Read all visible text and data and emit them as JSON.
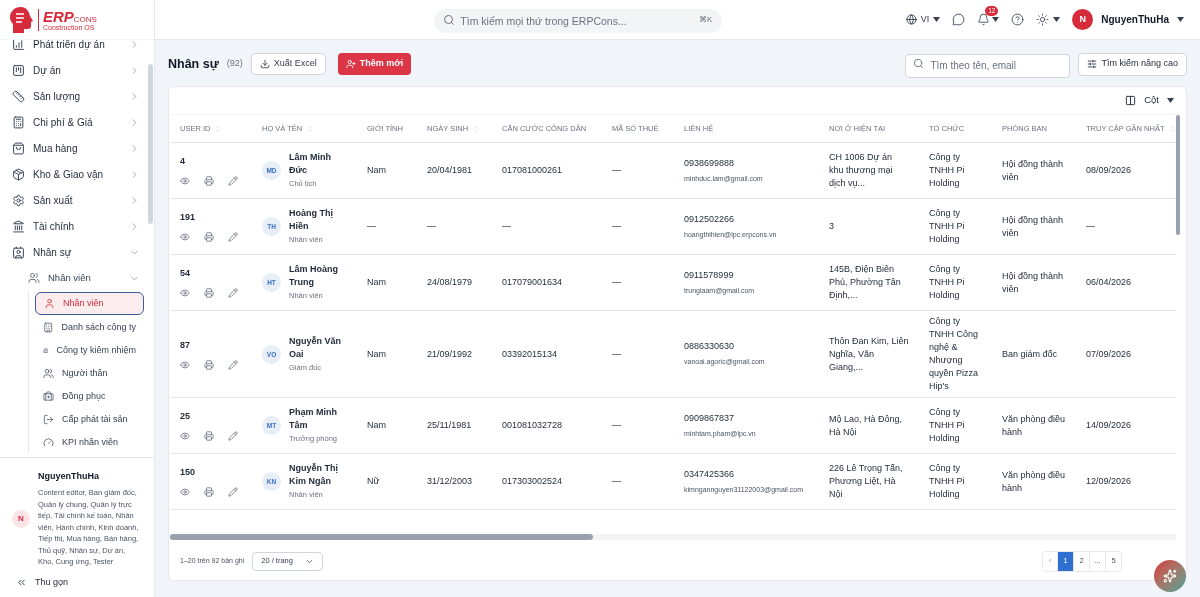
{
  "logo": {
    "name": "ERP",
    "suffix": "CONS",
    "tagline": "Construction OS"
  },
  "header": {
    "search_placeholder": "Tìm kiếm mọi thứ trong ERPCons...",
    "shortcut": "⌘K",
    "language": "VI",
    "notifications": "12",
    "user": "NguyenThuHa",
    "avatar": "N"
  },
  "sidebar": {
    "items": [
      {
        "label": "Phát triển dự án",
        "expanded": false
      },
      {
        "label": "Dự án",
        "expanded": false
      },
      {
        "label": "Sản lượng",
        "expanded": false
      },
      {
        "label": "Chi phí & Giá",
        "expanded": false
      },
      {
        "label": "Mua hàng",
        "expanded": false
      },
      {
        "label": "Kho & Giao vận",
        "expanded": false
      },
      {
        "label": "Sản xuất",
        "expanded": false
      },
      {
        "label": "Tài chính",
        "expanded": false
      },
      {
        "label": "Nhân sự",
        "expanded": true,
        "children": [
          {
            "label": "Nhân viên",
            "expanded": true,
            "children": [
              {
                "label": "Nhân viên",
                "selected": true
              },
              {
                "label": "Danh sách công ty",
                "selected": false
              },
              {
                "label": "Công ty kiêm nhiệm",
                "selected": false
              },
              {
                "label": "Người thân",
                "selected": false
              },
              {
                "label": "Đồng phục",
                "selected": false
              },
              {
                "label": "Cấp phát tài sản",
                "selected": false
              },
              {
                "label": "KPI nhân viên",
                "selected": false
              }
            ]
          }
        ]
      }
    ],
    "user": {
      "name": "NguyenThuHa",
      "avatar": "N",
      "roles": "Content editor, Ban giám đốc, Quản lý chung, Quản lý trực tiếp, Tài chính kế toán, Nhân viên, Hành chính, Kinh doanh, Tiếp thị, Mua hàng, Bán hàng, Thủ quỹ, Nhân sự, Dự án, Kho, Cung ứng, Tester"
    },
    "collapse": "Thu gọn"
  },
  "page": {
    "title": "Nhân sự",
    "count": "(92)",
    "export": "Xuất Excel",
    "add": "Thêm mới",
    "search_placeholder": "Tìm theo tên, email",
    "advanced": "Tìm kiếm nâng cao",
    "columns_button": "Cột"
  },
  "table": {
    "columns": [
      {
        "label": "USER ID",
        "sortable": true
      },
      {
        "label": "HỌ VÀ TÊN",
        "sortable": true
      },
      {
        "label": "GIỚI TÍNH",
        "sortable": false
      },
      {
        "label": "NGÀY SINH",
        "sortable": true
      },
      {
        "label": "CĂN CƯỚC CÔNG DÂN",
        "sortable": false
      },
      {
        "label": "MÃ SỐ THUẾ",
        "sortable": false
      },
      {
        "label": "LIÊN HỆ",
        "sortable": false
      },
      {
        "label": "NƠI Ở HIỆN TẠI",
        "sortable": false
      },
      {
        "label": "TỔ CHỨC",
        "sortable": false
      },
      {
        "label": "PHÒNG BAN",
        "sortable": false
      },
      {
        "label": "TRUY CẬP GẦN NHẤT",
        "sortable": true
      }
    ],
    "rows": [
      {
        "id": "4",
        "initials": "MD",
        "name": "Lâm Minh Đức",
        "role": "Chủ tịch",
        "gender": "Nam",
        "dob": "20/04/1981",
        "cccd": "017081000261",
        "tax": "—",
        "phone": "0938699888",
        "email": "minhduc.lam@gmail.com",
        "address": "CH 1006 Dự án khu thương mại dịch vụ...",
        "org": "Công ty TNHH Pi Holding",
        "dept": "Hội đồng thành viên",
        "last": "08/09/2026"
      },
      {
        "id": "191",
        "initials": "TH",
        "name": "Hoàng Thị Hiền",
        "role": "Nhân viên",
        "gender": "—",
        "dob": "—",
        "cccd": "—",
        "tax": "—",
        "phone": "0912502266",
        "email": "hoangthihien@lpc.erpcons.vn",
        "address": "3",
        "org": "Công ty TNHH Pi Holding",
        "dept": "Hội đồng thành viên",
        "last": "—"
      },
      {
        "id": "54",
        "initials": "HT",
        "name": "Lâm Hoàng Trung",
        "role": "Nhân viên",
        "gender": "Nam",
        "dob": "24/08/1979",
        "cccd": "017079001634",
        "tax": "—",
        "phone": "0911578999",
        "email": "trunglaam@gmail.com",
        "address": "145B, Điện Biên Phủ, Phường Tân Định,...",
        "org": "Công ty TNHH Pi Holding",
        "dept": "Hội đồng thành viên",
        "last": "06/04/2026"
      },
      {
        "id": "87",
        "initials": "VO",
        "name": "Nguyễn Văn Oai",
        "role": "Giám đốc",
        "gender": "Nam",
        "dob": "21/09/1992",
        "cccd": "03392015134",
        "tax": "—",
        "phone": "0886330630",
        "email": "vanoai.agoric@gmail.com",
        "address": "Thôn Đan Kim, Liên Nghĩa, Văn Giang,...",
        "org": "Công ty TNHH Công nghệ & Nhượng quyền Pizza Hip's",
        "dept": "Ban giám đốc",
        "last": "07/09/2026"
      },
      {
        "id": "25",
        "initials": "MT",
        "name": "Phạm Minh Tâm",
        "role": "Trưởng phòng",
        "gender": "Nam",
        "dob": "25/11/1981",
        "cccd": "001081032728",
        "tax": "—",
        "phone": "0909867837",
        "email": "minhtam.pham@lpc.vn",
        "address": "Mộ Lao, Hà Đông, Hà Nội",
        "org": "Công ty TNHH Pi Holding",
        "dept": "Văn phòng điều hành",
        "last": "14/09/2026"
      },
      {
        "id": "150",
        "initials": "KN",
        "name": "Nguyễn Thị Kim Ngân",
        "role": "Nhân viên",
        "gender": "Nữ",
        "dob": "31/12/2003",
        "cccd": "017303002524",
        "tax": "—",
        "phone": "0347425366",
        "email": "kimngannguyen31122003@gmail.com",
        "address": "226 Lê Trọng Tấn, Phương Liệt, Hà Nội",
        "org": "Công ty TNHH Pi Holding",
        "dept": "Văn phòng điều hành",
        "last": "12/09/2026"
      }
    ]
  },
  "footer": {
    "range": "1–20 trên 92 bản ghi",
    "page_size": "20 / trang",
    "prev": "‹",
    "pages": [
      {
        "label": "1",
        "selected": true
      },
      {
        "label": "2",
        "selected": false
      },
      {
        "label": "...",
        "selected": false
      },
      {
        "label": "5",
        "selected": false
      }
    ]
  }
}
